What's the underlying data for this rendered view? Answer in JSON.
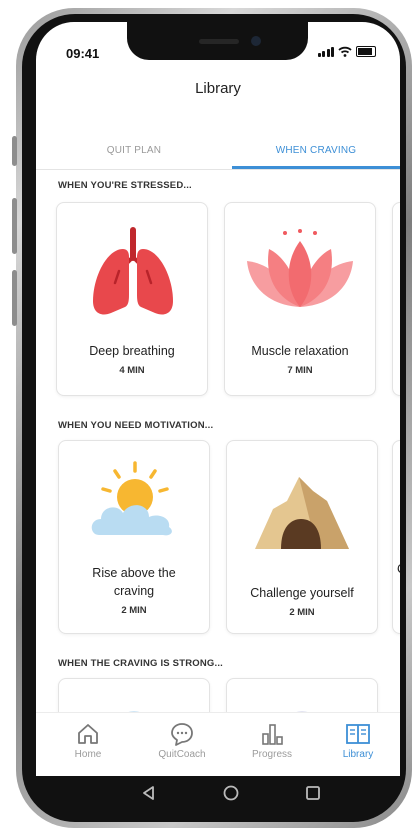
{
  "status": {
    "time": "09:41"
  },
  "header": {
    "title": "Library"
  },
  "tabs": [
    {
      "label": "QUIT PLAN",
      "active": false
    },
    {
      "label": "WHEN CRAVING",
      "active": true
    }
  ],
  "sections": [
    {
      "label": "WHEN YOU'RE STRESSED...",
      "cards": [
        {
          "title": "Deep breathing",
          "duration": "4 MIN",
          "icon": "lungs-icon"
        },
        {
          "title": "Muscle relaxation",
          "duration": "7 MIN",
          "icon": "lotus-icon"
        }
      ]
    },
    {
      "label": "WHEN YOU NEED MOTIVATION...",
      "cards": [
        {
          "title_line1": "Rise above the",
          "title_line2": "craving",
          "duration": "2 MIN",
          "icon": "sun-cloud-icon"
        },
        {
          "title": "Challenge yourself",
          "duration": "2 MIN",
          "icon": "cave-icon"
        },
        {
          "title_partial": "C"
        }
      ]
    },
    {
      "label": "WHEN THE CRAVING IS STRONG..."
    }
  ],
  "nav": [
    {
      "label": "Home",
      "icon": "home-icon",
      "active": false
    },
    {
      "label": "QuitCoach",
      "icon": "chat-bubble-icon",
      "active": false
    },
    {
      "label": "Progress",
      "icon": "bar-chart-icon",
      "active": false
    },
    {
      "label": "Library",
      "icon": "book-icon",
      "active": true
    }
  ],
  "colors": {
    "accent": "#3d8fd6",
    "lungs": "#e8484c",
    "lotus": "#f57f82",
    "cloud": "#b9dcf2",
    "sun": "#f7b731",
    "cave": "#d8b27a"
  }
}
